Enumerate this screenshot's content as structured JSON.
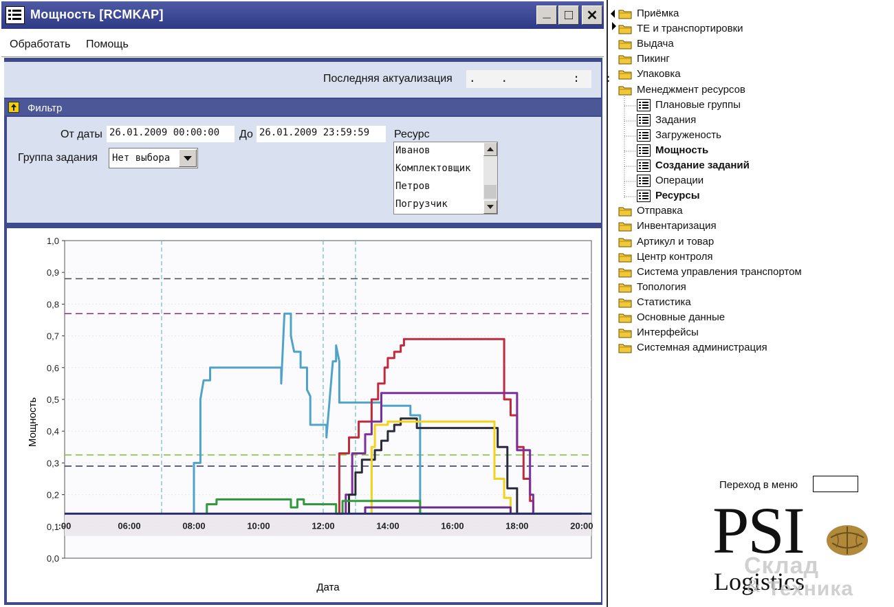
{
  "window": {
    "title": "Мощность [RCMKAP]",
    "buttons": {
      "minimize": "_",
      "maximize": "□",
      "close": "✕"
    }
  },
  "menu": {
    "items": [
      "Обработать",
      "Помощь"
    ]
  },
  "header": {
    "last_update_label": "Последняя актуализация",
    "last_update_value": ".   .        :   :"
  },
  "filter": {
    "title": "Фильтр",
    "from_label": "От даты",
    "from_value": "26.01.2009 00:00:00",
    "to_label": "До",
    "to_value": "26.01.2009 23:59:59",
    "group_label": "Группа задания",
    "group_value": "Нет выбора",
    "resource_label": "Ресурс",
    "resources": [
      "Иванов",
      "Комплектовщик",
      "Петров",
      "Погрузчик"
    ]
  },
  "chart_data": {
    "type": "line",
    "xlabel": "Дата",
    "ylabel": "Мощность",
    "ylim": [
      0,
      1.0
    ],
    "yticks": [
      "0,0",
      "0,1",
      "0,2",
      "0,3",
      "0,4",
      "0,5",
      "0,6",
      "0,7",
      "0,8",
      "0,9",
      "1,0"
    ],
    "xticks": [
      "06:00",
      "08:00",
      "10:00",
      "12:00",
      "14:00",
      "16:00",
      "18:00",
      "20:00"
    ],
    "xlim": [
      4.0,
      20.3
    ],
    "reference_lines": [
      {
        "y": 0.88,
        "color": "#555555"
      },
      {
        "y": 0.77,
        "color": "#8a2b8a"
      },
      {
        "y": 0.325,
        "color": "#8ac43a"
      },
      {
        "y": 0.29,
        "color": "#3a3a7a"
      }
    ],
    "vertical_lines": [
      7.0,
      12.0,
      13.0
    ],
    "series": [
      {
        "color": "#4fa3c8",
        "points": [
          [
            8.0,
            0.14
          ],
          [
            8.0,
            0.3
          ],
          [
            8.2,
            0.3
          ],
          [
            8.2,
            0.5
          ],
          [
            8.3,
            0.56
          ],
          [
            8.5,
            0.56
          ],
          [
            8.5,
            0.6
          ],
          [
            10.7,
            0.6
          ],
          [
            10.7,
            0.55
          ],
          [
            10.8,
            0.77
          ],
          [
            11.0,
            0.77
          ],
          [
            11.0,
            0.7
          ],
          [
            11.1,
            0.65
          ],
          [
            11.3,
            0.65
          ],
          [
            11.3,
            0.6
          ],
          [
            11.5,
            0.6
          ],
          [
            11.5,
            0.53
          ],
          [
            11.6,
            0.51
          ],
          [
            11.6,
            0.42
          ],
          [
            12.1,
            0.42
          ],
          [
            12.1,
            0.38
          ],
          [
            12.3,
            0.62
          ],
          [
            12.4,
            0.62
          ],
          [
            12.4,
            0.67
          ],
          [
            12.5,
            0.62
          ],
          [
            12.5,
            0.49
          ],
          [
            13.8,
            0.49
          ],
          [
            13.8,
            0.48
          ],
          [
            14.7,
            0.48
          ],
          [
            14.7,
            0.45
          ],
          [
            15.0,
            0.45
          ],
          [
            15.0,
            0.14
          ]
        ]
      },
      {
        "color": "#c02a3a",
        "points": [
          [
            12.5,
            0.14
          ],
          [
            12.5,
            0.33
          ],
          [
            12.8,
            0.33
          ],
          [
            12.8,
            0.38
          ],
          [
            13.1,
            0.38
          ],
          [
            13.1,
            0.43
          ],
          [
            13.5,
            0.43
          ],
          [
            13.5,
            0.5
          ],
          [
            13.7,
            0.5
          ],
          [
            13.7,
            0.55
          ],
          [
            13.9,
            0.55
          ],
          [
            13.9,
            0.6
          ],
          [
            14.0,
            0.6
          ],
          [
            14.0,
            0.63
          ],
          [
            14.2,
            0.63
          ],
          [
            14.2,
            0.65
          ],
          [
            14.4,
            0.65
          ],
          [
            14.4,
            0.67
          ],
          [
            14.5,
            0.67
          ],
          [
            14.5,
            0.69
          ],
          [
            17.6,
            0.69
          ],
          [
            17.6,
            0.5
          ],
          [
            17.8,
            0.5
          ],
          [
            17.8,
            0.45
          ],
          [
            18.0,
            0.45
          ],
          [
            18.0,
            0.35
          ],
          [
            18.2,
            0.35
          ],
          [
            18.2,
            0.25
          ],
          [
            18.4,
            0.25
          ],
          [
            18.4,
            0.18
          ],
          [
            18.5,
            0.18
          ],
          [
            18.5,
            0.14
          ]
        ]
      },
      {
        "color": "#7a2f9a",
        "points": [
          [
            12.7,
            0.14
          ],
          [
            12.7,
            0.2
          ],
          [
            12.9,
            0.2
          ],
          [
            12.9,
            0.33
          ],
          [
            13.3,
            0.33
          ],
          [
            13.3,
            0.39
          ],
          [
            13.5,
            0.39
          ],
          [
            13.5,
            0.43
          ],
          [
            13.8,
            0.43
          ],
          [
            13.8,
            0.52
          ],
          [
            18.0,
            0.52
          ],
          [
            18.0,
            0.34
          ],
          [
            18.4,
            0.34
          ],
          [
            18.4,
            0.2
          ],
          [
            18.5,
            0.2
          ],
          [
            18.5,
            0.14
          ]
        ]
      },
      {
        "color": "#2a2a3a",
        "points": [
          [
            12.8,
            0.14
          ],
          [
            12.8,
            0.2
          ],
          [
            13.0,
            0.2
          ],
          [
            13.0,
            0.27
          ],
          [
            13.2,
            0.27
          ],
          [
            13.2,
            0.31
          ],
          [
            13.6,
            0.31
          ],
          [
            13.6,
            0.34
          ],
          [
            13.8,
            0.34
          ],
          [
            13.8,
            0.37
          ],
          [
            14.0,
            0.37
          ],
          [
            14.0,
            0.4
          ],
          [
            14.2,
            0.4
          ],
          [
            14.2,
            0.42
          ],
          [
            14.4,
            0.42
          ],
          [
            14.4,
            0.44
          ],
          [
            14.9,
            0.44
          ],
          [
            14.9,
            0.41
          ],
          [
            17.4,
            0.41
          ],
          [
            17.4,
            0.35
          ],
          [
            17.7,
            0.35
          ],
          [
            17.7,
            0.22
          ],
          [
            18.0,
            0.22
          ],
          [
            18.0,
            0.14
          ]
        ]
      },
      {
        "color": "#f2d21a",
        "points": [
          [
            13.5,
            0.14
          ],
          [
            13.5,
            0.35
          ],
          [
            13.6,
            0.35
          ],
          [
            13.6,
            0.42
          ],
          [
            14.0,
            0.42
          ],
          [
            14.0,
            0.43
          ],
          [
            17.3,
            0.43
          ],
          [
            17.3,
            0.25
          ],
          [
            17.6,
            0.25
          ],
          [
            17.6,
            0.19
          ],
          [
            17.8,
            0.19
          ],
          [
            17.8,
            0.14
          ]
        ]
      },
      {
        "color": "#2f9a3a",
        "points": [
          [
            8.4,
            0.14
          ],
          [
            8.4,
            0.17
          ],
          [
            8.7,
            0.17
          ],
          [
            8.7,
            0.185
          ],
          [
            11.0,
            0.185
          ],
          [
            11.0,
            0.16
          ],
          [
            11.2,
            0.16
          ],
          [
            11.2,
            0.185
          ],
          [
            11.4,
            0.185
          ],
          [
            11.4,
            0.17
          ],
          [
            12.4,
            0.17
          ],
          [
            12.4,
            0.14
          ],
          [
            12.6,
            0.14
          ],
          [
            12.6,
            0.18
          ],
          [
            15.0,
            0.18
          ],
          [
            15.0,
            0.14
          ],
          [
            20.0,
            0.14
          ]
        ]
      },
      {
        "color": "#6a2a8a",
        "points": [
          [
            13.3,
            0.14
          ],
          [
            13.3,
            0.16
          ],
          [
            17.8,
            0.16
          ],
          [
            17.8,
            0.14
          ]
        ]
      },
      {
        "color": "#2a2a6a",
        "points": [
          [
            4.0,
            0.14
          ],
          [
            20.3,
            0.14
          ]
        ]
      }
    ]
  },
  "tree": {
    "items": [
      {
        "label": "Приёмка",
        "type": "folder",
        "bold": false,
        "indent": 0
      },
      {
        "label": "ТЕ и транспортировки",
        "type": "folder",
        "bold": false,
        "indent": 0
      },
      {
        "label": "Выдача",
        "type": "folder",
        "bold": false,
        "indent": 0
      },
      {
        "label": "Пикинг",
        "type": "folder",
        "bold": false,
        "indent": 0
      },
      {
        "label": "Упаковка",
        "type": "folder",
        "bold": false,
        "indent": 0
      },
      {
        "label": "Менеджмент ресурсов",
        "type": "folder-open",
        "bold": false,
        "indent": 0
      },
      {
        "label": "Плановые группы",
        "type": "doc",
        "bold": false,
        "indent": 1
      },
      {
        "label": "Задания",
        "type": "doc",
        "bold": false,
        "indent": 1
      },
      {
        "label": "Загруженость",
        "type": "doc",
        "bold": false,
        "indent": 1
      },
      {
        "label": "Мощность",
        "type": "doc",
        "bold": true,
        "indent": 1
      },
      {
        "label": "Создание заданий",
        "type": "doc",
        "bold": true,
        "indent": 1
      },
      {
        "label": "Операции",
        "type": "doc",
        "bold": false,
        "indent": 1
      },
      {
        "label": "Ресурсы",
        "type": "doc",
        "bold": true,
        "indent": 1
      },
      {
        "label": "Отправка",
        "type": "folder",
        "bold": false,
        "indent": 0
      },
      {
        "label": "Инвентаризация",
        "type": "folder",
        "bold": false,
        "indent": 0
      },
      {
        "label": "Артикул и товар",
        "type": "folder",
        "bold": false,
        "indent": 0
      },
      {
        "label": "Центр контроля",
        "type": "folder",
        "bold": false,
        "indent": 0
      },
      {
        "label": "Система управления транспортом",
        "type": "folder",
        "bold": false,
        "indent": 0
      },
      {
        "label": "Топология",
        "type": "folder",
        "bold": false,
        "indent": 0
      },
      {
        "label": "Статистика",
        "type": "folder",
        "bold": false,
        "indent": 0
      },
      {
        "label": "Основные данные",
        "type": "folder",
        "bold": false,
        "indent": 0
      },
      {
        "label": "Интерфейсы",
        "type": "folder",
        "bold": false,
        "indent": 0
      },
      {
        "label": "Системная администрация",
        "type": "folder",
        "bold": false,
        "indent": 0
      }
    ],
    "goto_label": "Переход в меню",
    "goto_value": ""
  },
  "branding": {
    "logo_main": "PSI",
    "logo_sub": "Logistics",
    "watermark_line1": "Склад",
    "watermark_amp": "&",
    "watermark_line2": "Техника"
  }
}
